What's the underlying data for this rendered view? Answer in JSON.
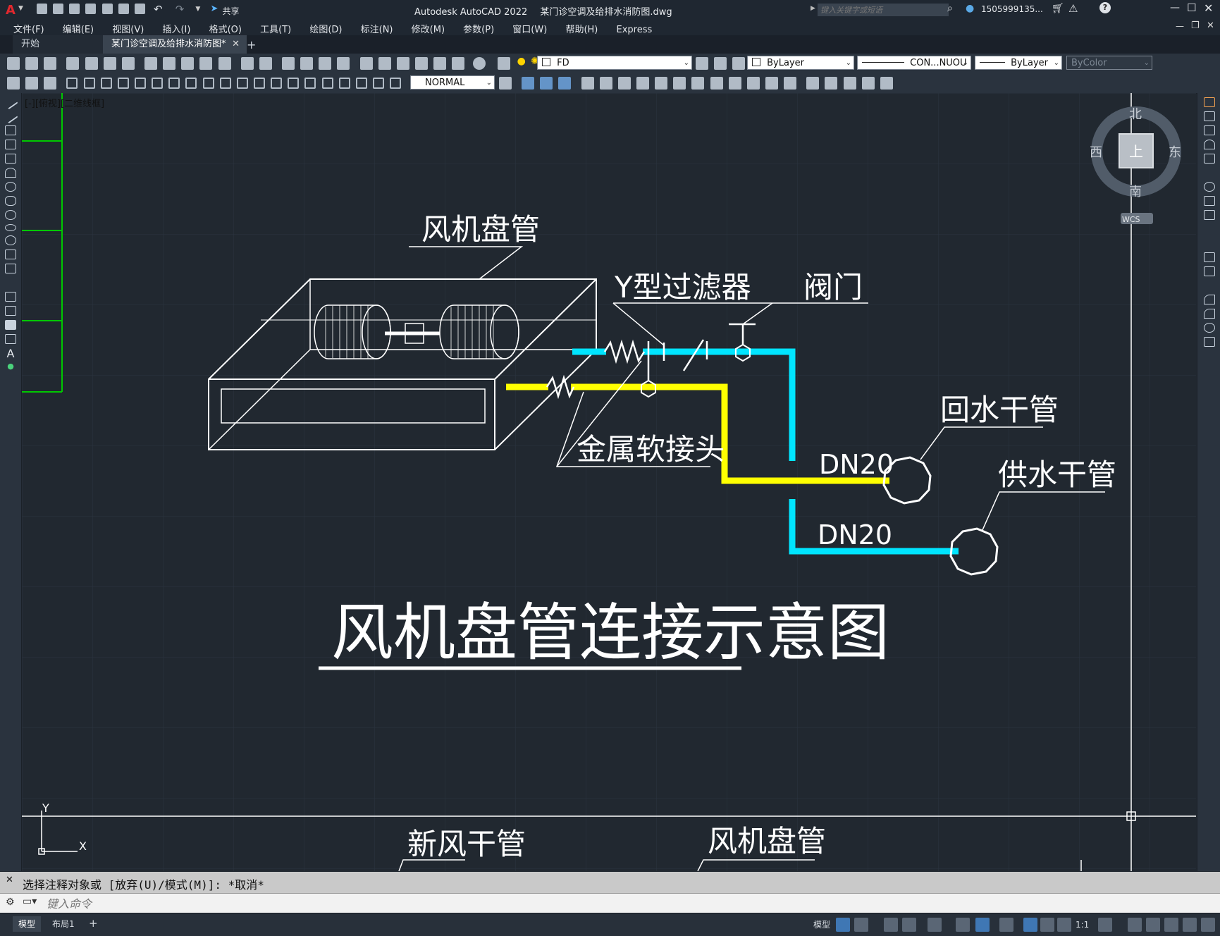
{
  "app": {
    "title": "Autodesk AutoCAD 2022",
    "document": "某门诊空调及给排水消防图.dwg",
    "share_label": "共享",
    "search_placeholder": "键入关键字或短语",
    "user": "1505999135..."
  },
  "menu": [
    "文件(F)",
    "编辑(E)",
    "视图(V)",
    "插入(I)",
    "格式(O)",
    "工具(T)",
    "绘图(D)",
    "标注(N)",
    "修改(M)",
    "参数(P)",
    "窗口(W)",
    "帮助(H)",
    "Express"
  ],
  "tabs": [
    {
      "label": "开始",
      "active": false
    },
    {
      "label": "某门诊空调及给排水消防图*",
      "active": true
    }
  ],
  "toolbar": {
    "layer": "FD",
    "color": "ByLayer",
    "linetype": "CON...NUOU",
    "lineweight": "ByLayer",
    "plotstyle": "ByColor",
    "dimstyle": "NORMAL"
  },
  "viewport": {
    "label": "[-][俯视][二维线框]",
    "compass": {
      "north": "北",
      "south": "南",
      "east": "东",
      "west": "西",
      "top": "上",
      "ucs": "WCS"
    },
    "axis_x": "X",
    "axis_y": "Y"
  },
  "drawing": {
    "label_fcu": "风机盘管",
    "label_y_filter": "Y型过滤器",
    "label_valve": "阀门",
    "label_return_main": "回水干管",
    "label_supply_main": "供水干管",
    "label_flex_joint": "金属软接头",
    "label_dn_return": "DN20",
    "label_dn_supply": "DN20",
    "title": "风机盘管连接示意图",
    "bottom_label_fresh_air": "新风干管",
    "bottom_label_fcu": "风机盘管",
    "colors": {
      "cyan": "#00e5ff",
      "yellow": "#ffff00",
      "white": "#ffffff",
      "green": "#00c800"
    }
  },
  "command": {
    "history": "选择注释对象或 [放弃(U)/模式(M)]: *取消*",
    "placeholder": "键入命令"
  },
  "status": {
    "layout_tabs": [
      "模型",
      "布局1"
    ],
    "model_label": "模型",
    "scale": "1:1"
  }
}
